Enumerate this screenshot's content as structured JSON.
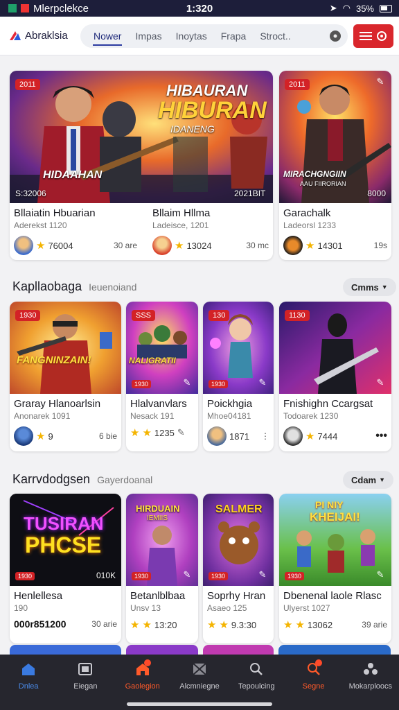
{
  "status_bar": {
    "app_name": "Mlerpclekce",
    "time": "1:320",
    "battery": "35%"
  },
  "header": {
    "logo_text": "Abraklsia",
    "tabs": [
      {
        "label": "Nower",
        "active": true
      },
      {
        "label": "Impas"
      },
      {
        "label": "Inoytas"
      },
      {
        "label": "Frapa"
      },
      {
        "label": "Stroct.."
      }
    ]
  },
  "featured": [
    {
      "badge": "2011",
      "art_title": "HIBAURAN",
      "art_subtitle": "HIBURAN",
      "art_sub2": "IDANENG",
      "art_caption": "HIDAAHAN",
      "bottom_left": "S:32006",
      "bottom_right": "2021BIT",
      "title": "Bllaiatin Hbuarian",
      "subtitle": "Aderekst 1120",
      "rating": "76004",
      "right": "30 are"
    },
    {
      "title": "Bllaim Hllma",
      "subtitle": "Ladeisce, 1201",
      "rating": "13024",
      "right": "30 mc"
    },
    {
      "badge": "2011",
      "art_caption": "MIRACHGNGIIN",
      "art_sub": "AAU FIIRORIAN",
      "bottom_right": "8000",
      "title": "Garachalk",
      "subtitle": "Ladeorsl 1233",
      "rating": "14301",
      "right": "19s"
    }
  ],
  "section2": {
    "title": "Kapllaobaga",
    "subtitle": "Ieuenoiand",
    "sort_label": "Cmms",
    "cards": [
      {
        "badge": "1930",
        "art_text": "FANGNINZAIN!",
        "title": "Graray Hlanoarlsin",
        "subtitle": "Anonarek 1091",
        "rating": "9",
        "right": "6 bie"
      },
      {
        "badge": "SSS",
        "bottom_badge": "1930",
        "art_text": "NALIGRATII",
        "title": "Hlalvanvlars",
        "subtitle": "Nesack 191",
        "rating": "1235"
      },
      {
        "badge": "130",
        "bottom_badge": "1930",
        "title": "Poickhgia",
        "subtitle": "Mhoe04181",
        "rating": "1871"
      },
      {
        "badge": "1130",
        "title": "Fnishighn Ccargsat",
        "subtitle": "Todoarek 1230",
        "rating": "7444"
      }
    ]
  },
  "section3": {
    "title": "Karrvdodgsen",
    "subtitle": "Gayerdoanal",
    "sort_label": "Cdam",
    "cards": [
      {
        "art_line1": "TUSIRAN",
        "art_line2": "PHCSE",
        "bottom_badge": "1930",
        "bottom_right": "010K",
        "title": "Henlellesa",
        "subtitle": "190",
        "price": "000r851200",
        "right": "30 arie"
      },
      {
        "art_line1": "HIRDUAIN",
        "art_line2": "IEMIIS",
        "bottom_badge": "1930",
        "title": "Betanlblbaa",
        "subtitle": "Unsv 13",
        "rating": "13:20"
      },
      {
        "art_line1": "SALMER",
        "bottom_badge": "1930",
        "title": "Soprhy Hran",
        "subtitle": "Asaeo 125",
        "rating": "9.3:30"
      },
      {
        "art_line1": "PI NIY",
        "art_line2": "KHEIJAI!",
        "bottom_badge": "1930",
        "title": "Dbenenal laole Rlasc",
        "subtitle": "Ulyerst 1027",
        "rating": "13062",
        "right": "39 arie"
      }
    ]
  },
  "bottom_nav": [
    {
      "label": "Dnlea",
      "icon": "home-icon"
    },
    {
      "label": "Eiegan",
      "icon": "image-icon"
    },
    {
      "label": "Gaolegion",
      "icon": "house-icon",
      "active": true
    },
    {
      "label": "Alcmniegne",
      "icon": "crossed-image-icon"
    },
    {
      "label": "Tepoulcing",
      "icon": "search-icon"
    },
    {
      "label": "Segne",
      "icon": "search-notif-icon"
    },
    {
      "label": "Mokarploocs",
      "icon": "shapes-icon"
    }
  ],
  "colors": {
    "accent_red": "#d32226",
    "nav_active": "#ff5a2a",
    "tab_active": "#2a3aa0"
  }
}
